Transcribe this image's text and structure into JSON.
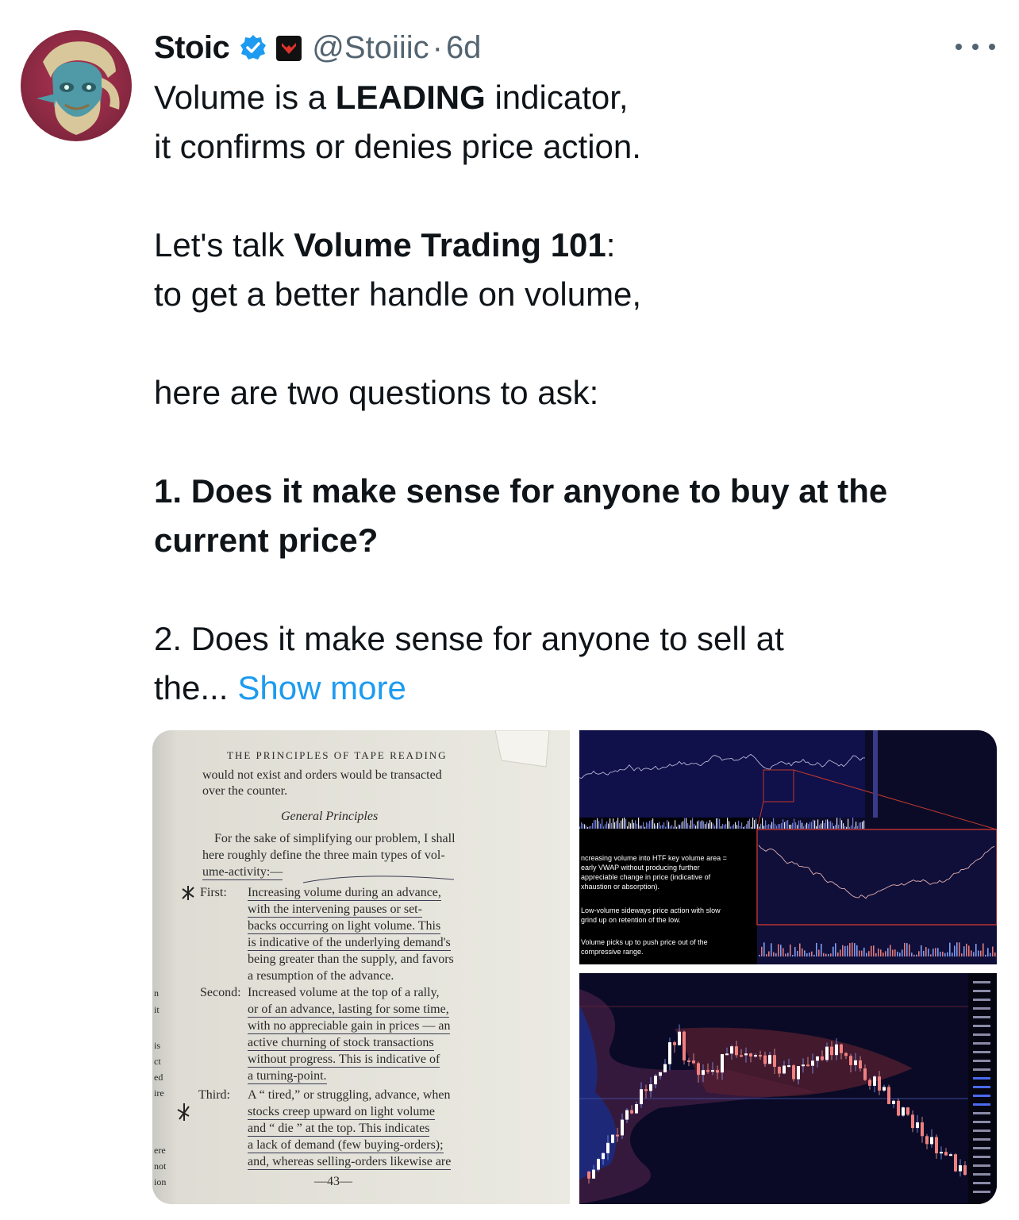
{
  "tweet": {
    "author_name": "Stoic",
    "handle": "@Stoiiic",
    "separator": "·",
    "time": "6d",
    "lines": [
      [
        "Volume is a ",
        "LEADING",
        " indicator,"
      ],
      "it confirms or denies price action.",
      [
        "Let's talk ",
        "Volume Trading 101",
        ":"
      ],
      "to get a better handle on volume,",
      "here are two questions to ask:",
      "1. Does it make sense for anyone to buy at the",
      "current price?",
      "2. Does it make sense for anyone to sell at",
      "the..."
    ],
    "show_more": "Show more"
  },
  "icons": {
    "verified": "verified-badge-icon",
    "affiliation": "affiliate-badge-icon",
    "more": "more-options-icon",
    "colors": {
      "verified": "#1d9bf0",
      "link": "#1d9bf0",
      "muted": "#536471"
    }
  },
  "book_page": {
    "header": "THE PRINCIPLES OF TAPE READING",
    "intro": [
      "would not exist and orders would be transacted",
      "over the counter."
    ],
    "section_title": "General Principles",
    "paragraph": [
      "For the sake of simplifying our problem, I shall",
      "here roughly define the three main types of vol-",
      "ume-activity:—"
    ],
    "first_label": "First:",
    "first_lines": [
      "Increasing volume during an advance,",
      "with the intervening pauses or set-",
      "backs occurring on light volume. This",
      "is indicative of the underlying demand's",
      "being greater than the supply, and favors",
      "a resumption of the advance."
    ],
    "second_label": "Second:",
    "second_lines": [
      "Increased volume at the top of a rally,",
      "or of an advance, lasting for some time,",
      "with no appreciable gain in prices — an",
      "active churning of stock transactions",
      "without progress. This is indicative of",
      "a turning-point."
    ],
    "third_label": "Third:",
    "third_lines": [
      "A “ tired,” or struggling, advance, when",
      "stocks creep upward on light volume",
      "and “ die ” at the top. This indicates",
      "a lack of demand (few buying-orders);",
      "and, whereas selling-orders likewise are"
    ],
    "page_number": "—43—",
    "margin_fragments": [
      "n",
      "it",
      "is",
      "ct",
      "ed",
      "ire",
      "ere",
      "not",
      "ion"
    ]
  },
  "chart_annotations": {
    "notes": [
      [
        "ncreasing volume into HTF key volume area =",
        "early VWAP without producing further",
        "appreciable change in price (indicative of",
        "xhaustion or absorption)."
      ],
      [
        "Low-volume sideways price action with slow",
        "grind up on retention of the low."
      ],
      [
        "Volume picks up to push price out of the",
        "compressive range."
      ]
    ]
  }
}
